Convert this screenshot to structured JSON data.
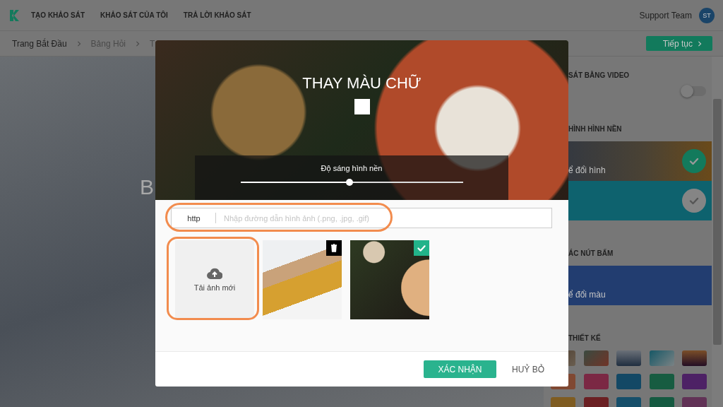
{
  "nav": {
    "links": [
      "TẠO KHẢO SÁT",
      "KHẢO SÁT CỦA TÔI",
      "TRẢ LỜI KHẢO SÁT"
    ],
    "user": "Support Team",
    "avatar": "ST"
  },
  "breadcrumb": [
    "Trang Bắt Đầu",
    "Bảng Hỏi",
    "T"
  ],
  "next_button": "Tiếp tục",
  "background_heading": "B",
  "side_panel": {
    "sections": [
      {
        "kind": "toggle",
        "title": "SÁT BẰNG VIDEO",
        "on": false
      },
      {
        "kind": "cards",
        "title": "HÌNH HÌNH NỀN",
        "cards": [
          {
            "kind": "photo",
            "caption": "ể đổi hình",
            "selected": true
          },
          {
            "kind": "color",
            "color": "#0e626e",
            "selected": false
          }
        ]
      },
      {
        "kind": "cards",
        "title": "ÁC NÚT BẤM",
        "cards": [
          {
            "kind": "color",
            "color": "#223d70",
            "caption": "ể đổi màu"
          }
        ]
      },
      {
        "kind": "themes",
        "title": "THIẾT KẾ",
        "themes": [
          {
            "kind": "photo"
          },
          {
            "kind": "photo"
          },
          {
            "kind": "photo"
          },
          {
            "kind": "photo"
          },
          {
            "kind": "photo"
          },
          {
            "kind": "swatch",
            "color": "#804832"
          },
          {
            "kind": "swatch",
            "color": "#7b2844"
          },
          {
            "kind": "swatch",
            "color": "#134865"
          },
          {
            "kind": "swatch",
            "color": "#175c41"
          },
          {
            "kind": "swatch",
            "color": "#4d2165"
          },
          {
            "kind": "swatch",
            "color": "#7f5c21"
          },
          {
            "kind": "swatch",
            "color": "#6b2023"
          },
          {
            "kind": "swatch",
            "color": "#174f6a"
          },
          {
            "kind": "swatch",
            "color": "#155a41"
          },
          {
            "kind": "swatch",
            "color": "#613256"
          }
        ]
      }
    ]
  },
  "modal": {
    "title": "THAY MÀU CHỮ",
    "swatch": {
      "color": "#ffffff"
    },
    "brightness_label": "Độ sáng hình nền",
    "brightness": {
      "level": 0.49
    },
    "url_prefix": "http",
    "url_placeholder": "Nhập đường dẫn hình ảnh (.png, .jpg, .gif)",
    "upload_label": "Tải ảnh mới",
    "images": [
      {
        "selected": false
      },
      {
        "selected": true
      }
    ],
    "confirm": "XÁC NHẬN",
    "cancel": "HUỶ BỎ"
  }
}
